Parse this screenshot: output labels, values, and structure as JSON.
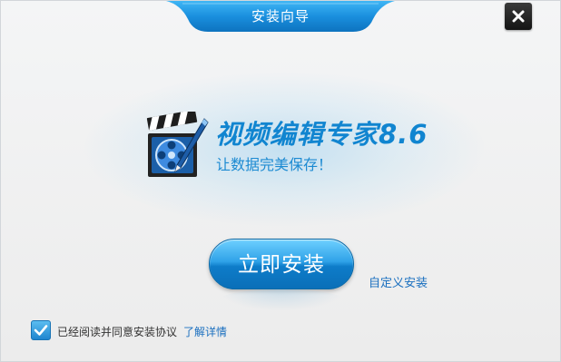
{
  "window": {
    "title": "安装向导",
    "close_icon": "close-icon"
  },
  "hero": {
    "product_name": "视频编辑专家8.6",
    "slogan": "让数据完美保存！",
    "icon": "clapperboard-film-reel-icon"
  },
  "actions": {
    "install_label": "立即安装",
    "custom_install_label": "自定义安装"
  },
  "agreement": {
    "checked": true,
    "text": "已经阅读并同意安装协议",
    "details_label": "了解详情"
  },
  "colors": {
    "accent": "#1185d0",
    "title_bar": "#1a8fde",
    "link": "#1a6fbf"
  }
}
